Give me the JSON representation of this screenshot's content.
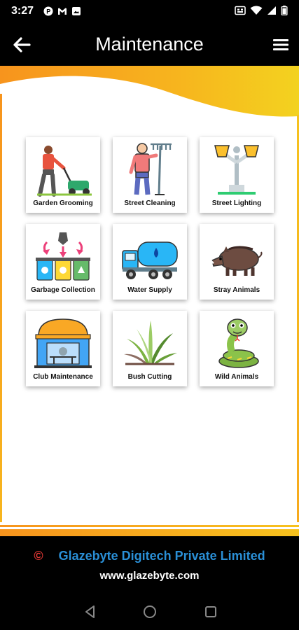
{
  "status_bar": {
    "time": "3:27",
    "left_icons": [
      "notification-p-icon",
      "gmail-icon",
      "image-icon"
    ],
    "right_icons": [
      "sim-icon",
      "wifi-icon",
      "signal-icon",
      "battery-icon"
    ]
  },
  "app_bar": {
    "title": "Maintenance",
    "back_icon": "arrow-left-icon",
    "menu_icon": "hamburger-menu-icon"
  },
  "colors": {
    "accent_orange": "#f7941d",
    "accent_yellow": "#f7c21e",
    "footer_company": "#2a8fd6",
    "copyright_red": "#e53935"
  },
  "tiles": [
    {
      "label": "Garden Grooming",
      "icon": "lawn-mower-icon"
    },
    {
      "label": "Street Cleaning",
      "icon": "street-cleaner-icon"
    },
    {
      "label": "Street Lighting",
      "icon": "street-lamp-icon"
    },
    {
      "label": "Garbage Collection",
      "icon": "recycle-bins-icon"
    },
    {
      "label": "Water Supply",
      "icon": "water-tanker-icon"
    },
    {
      "label": "Stray Animals",
      "icon": "boar-icon"
    },
    {
      "label": "Club Maintenance",
      "icon": "club-building-icon"
    },
    {
      "label": "Bush Cutting",
      "icon": "bush-icon"
    },
    {
      "label": "Wild Animals",
      "icon": "snake-icon"
    }
  ],
  "footer": {
    "copyright_symbol": "©",
    "company": "Glazebyte Digitech Private Limited",
    "website": "www.glazebyte.com"
  },
  "nav_bar": {
    "buttons": [
      "back-triangle-icon",
      "home-circle-icon",
      "recents-square-icon"
    ]
  }
}
